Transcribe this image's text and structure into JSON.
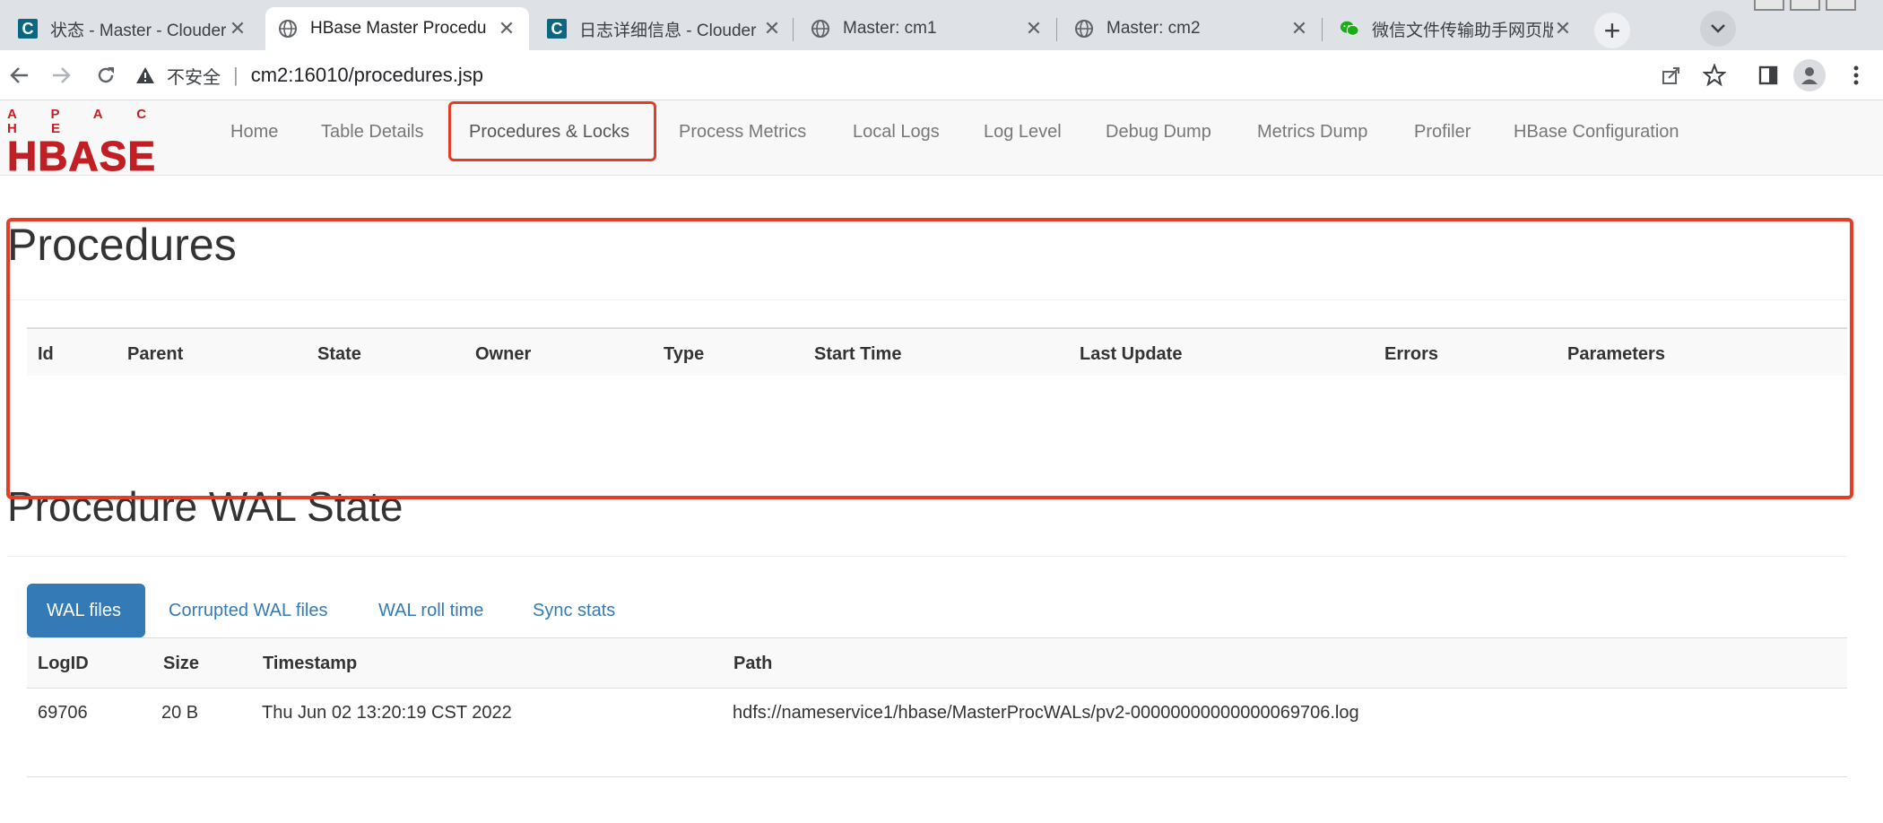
{
  "browser": {
    "tabs": [
      {
        "title": "状态 - Master - Clouder",
        "favicon": "cloudera-c-icon"
      },
      {
        "title": "HBase Master Procedu",
        "favicon": "globe-icon"
      },
      {
        "title": "日志详细信息 - Clouder",
        "favicon": "cloudera-c-icon"
      },
      {
        "title": "Master: cm1",
        "favicon": "globe-icon"
      },
      {
        "title": "Master: cm2",
        "favicon": "globe-icon"
      },
      {
        "title": "微信文件传输助手网页版",
        "favicon": "wechat-icon"
      }
    ],
    "insecure_label": "不安全",
    "url": "cm2:16010/procedures.jsp",
    "colors": {
      "tabstrip": "#dee1e6",
      "highlight": "#e53c27"
    }
  },
  "logo": {
    "top": "A P A C H E",
    "main": "HBASE",
    "color": "#c11f24"
  },
  "nav": {
    "items": [
      "Home",
      "Table Details",
      "Procedures & Locks",
      "Process Metrics",
      "Local Logs",
      "Log Level",
      "Debug Dump",
      "Metrics Dump",
      "Profiler",
      "HBase Configuration"
    ],
    "active": "Procedures & Locks"
  },
  "procedures": {
    "title": "Procedures",
    "columns": [
      "Id",
      "Parent",
      "State",
      "Owner",
      "Type",
      "Start Time",
      "Last Update",
      "Errors",
      "Parameters"
    ],
    "rows": []
  },
  "wal": {
    "title": "Procedure WAL State",
    "tabs": [
      "WAL files",
      "Corrupted WAL files",
      "WAL roll time",
      "Sync stats"
    ],
    "active_tab": "WAL files",
    "columns": [
      "LogID",
      "Size",
      "Timestamp",
      "Path"
    ],
    "rows": [
      [
        "69706",
        "20 B",
        "Thu Jun 02 13:20:19 CST 2022",
        "hdfs://nameservice1/hbase/MasterProcWALs/pv2-00000000000000069706.log"
      ]
    ]
  }
}
